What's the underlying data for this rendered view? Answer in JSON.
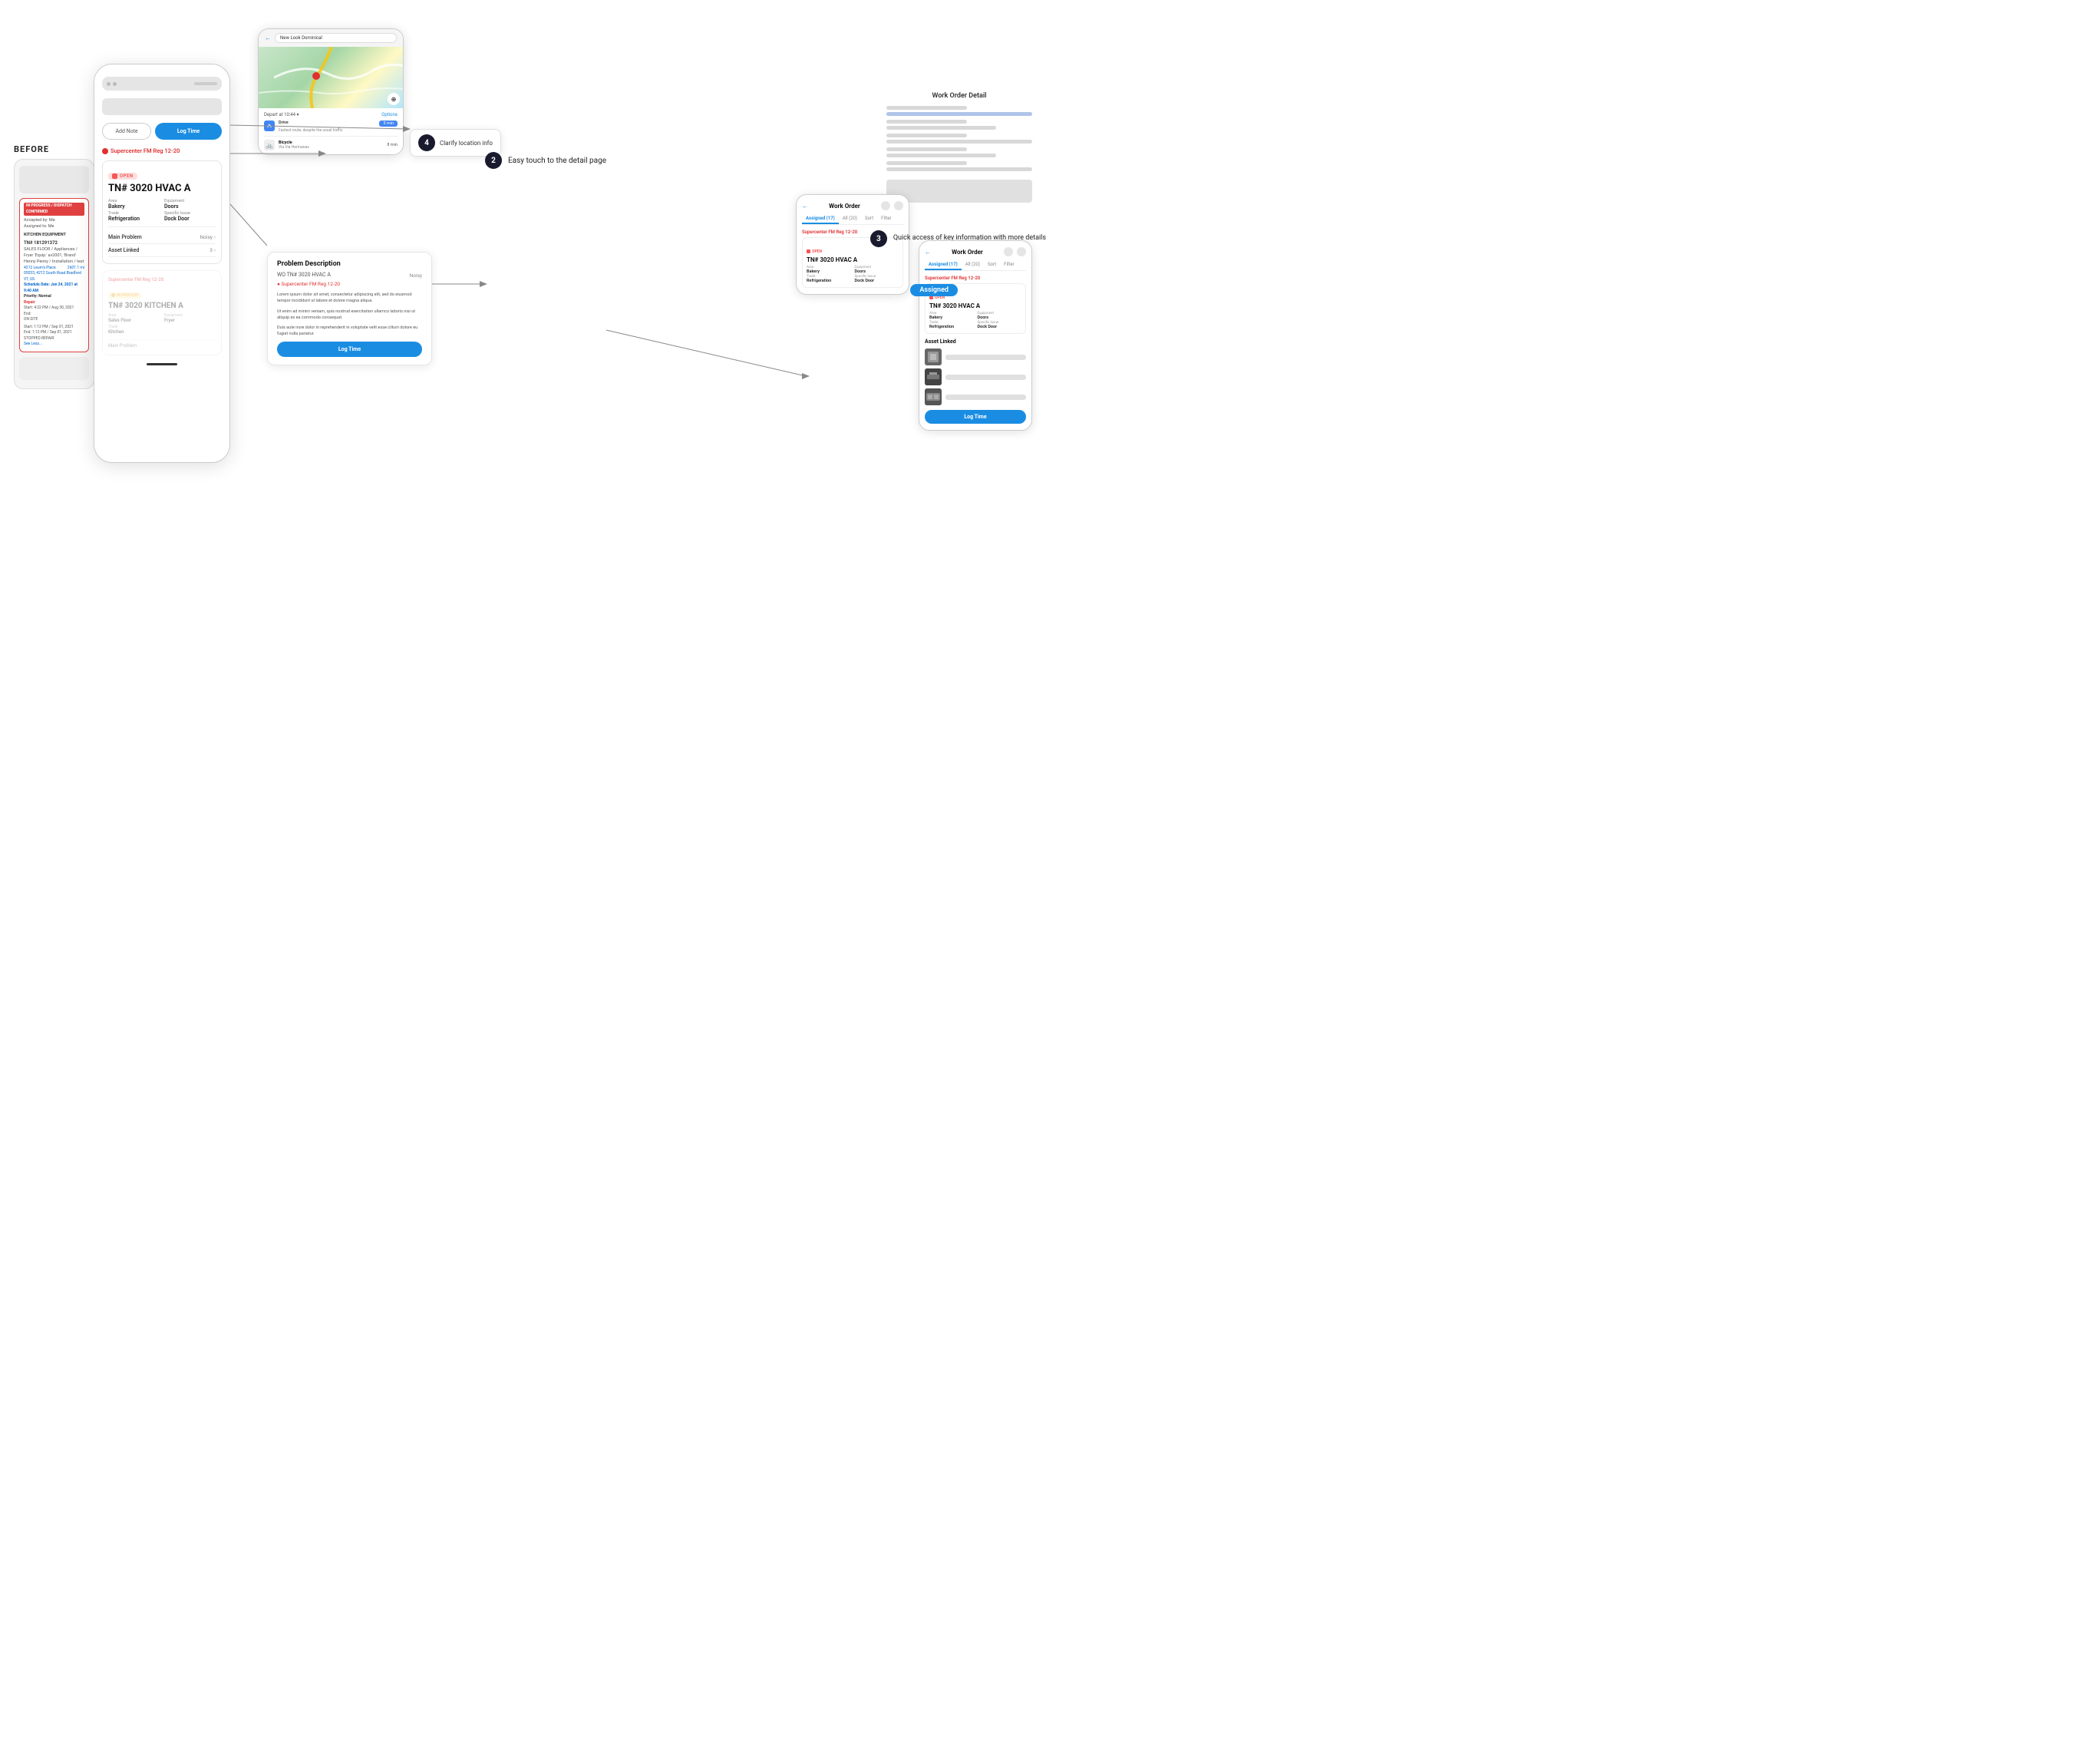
{
  "before_label": "BEFORE",
  "before_wo": {
    "status": "IN PROGRESS / DISPATCH CONFIRMED",
    "accepted": "Accepted by: Me",
    "assigned": "Assigned to: Me",
    "equipment": "KITCHEN EQUIPMENT",
    "tn": "TN# 181291372",
    "desc": "SALES FLOOR / Appliances / Fryer 'Equip.' av2001, 'Brand' Henny Penny / Installation / test",
    "addr1": "4212 Leurn's Place",
    "addr2": "05033, 4212 South Road Bradford VT, US",
    "sched": "Schedule Date: Jun 24, 2021 at 9:40 AM",
    "priority": "Priority: Normal",
    "repair1_label": "Repair",
    "repair1": "Start: 4:22 PM / Aug 30, 2021\nEnd:\nON SITE",
    "repair2": "Start: 1:12 PM / Sep 01, 2021\nEnd: 1:12 PM / Sep 01, 2021\nSTOPPED REPAIR",
    "see_less": "See Less..."
  },
  "main_phone": {
    "location": "Supercenter FM Reg 12-20",
    "wo_status": "OPEN",
    "wo_title": "TN# 3020 HVAC A",
    "area_label": "Area",
    "area_value": "Bakery",
    "equipment_label": "Equipment",
    "equipment_value": "Doors",
    "trade_label": "Trade",
    "trade_value": "Refrigeration",
    "specific_issue_label": "Specific Issue",
    "specific_issue_value": "Dock Door",
    "main_problem_label": "Main Problem",
    "main_problem_value": "Noisy",
    "asset_linked_label": "Asset Linked",
    "asset_linked_value": "3",
    "add_note_btn": "Add Note",
    "log_time_btn": "Log Time",
    "second_location": "Supercenter FM Reg 12-20",
    "second_status": "IN PROCESS",
    "second_title": "TN# 3020 KITCHEN A",
    "second_area_label": "Area",
    "second_area_value": "Sales Floor",
    "second_equip_label": "Equipment",
    "second_equip_value": "Fryer",
    "second_trade_label": "Trade",
    "second_trade_value": "Kitchen",
    "main_problem2": "Main Problem"
  },
  "callouts": {
    "num4": "4",
    "text4": "Clarify location info",
    "num2": "2",
    "text2": "Easy touch to the detail page",
    "num3": "3",
    "text3": "Quick access of key information with more details"
  },
  "wo_detail": {
    "title": "Work Order Detail"
  },
  "assigned_label": "Assigned",
  "map_phone": {
    "back": "←",
    "location": "New Look Dominical",
    "depart_label": "Depart at 10:44 ▾",
    "options": "Options",
    "drive_label": "Drive",
    "drive_fastest": "Fastest route, despite the usual traffic",
    "drive_time": "5 min",
    "bicycle_label": "Bicycle",
    "bicycle_via": "Via Via Hermanas",
    "bicycle_time": "8 min"
  },
  "phone3": {
    "back": "←",
    "title": "Work Order",
    "tabs": [
      "Assigned (17)",
      "All (20)",
      "Sort",
      "Filter"
    ],
    "active_tab": "Assigned (17)",
    "location": "Supercenter FM Reg 12-20",
    "status": "OPEN",
    "wo_title": "TN# 3020 HVAC A",
    "area_label": "Area",
    "area_value": "Bakery",
    "equip_label": "Equipment",
    "equip_value": "Doors",
    "trade_label": "Trade",
    "trade_value": "Refrigeration",
    "si_label": "Specific Issue",
    "si_value": "Dock Door"
  },
  "prob_panel": {
    "title": "Problem Description",
    "wo_ref": "WO TN# 3020 HVAC A",
    "noisy": "Noisy",
    "location": "Supercenter FM Reg 12-20",
    "body1": "Lorem ipsum dolor sit amet, consectetur adipiscing elit, sed do eiusmod tempor incididunt ut labore et dolore magna aliqua.",
    "body2": "Ut enim ad minim veniam, quis nostrud exercitation ullamco laboris nisi ut aliquip ex ea commodo consequat.",
    "body3": "Duis aute irure dolor in reprehenderit in voluptate velit esse cillum dolore eu fugiat nulla pariatur.",
    "log_btn": "Log Time"
  },
  "phone4": {
    "back": "←",
    "title": "Work Order",
    "tabs": [
      "Assigned (17)",
      "All (20)",
      "Sort",
      "Filter"
    ],
    "location": "Supercenter FM Reg 12-20",
    "status": "OPEN",
    "wo_title": "TN# 3020 HVAC A",
    "area_label": "Area",
    "area_value": "Bakery",
    "equip_label": "Equipment",
    "equip_value": "Doors",
    "trade_label": "Trade",
    "trade_value": "Refrigeration",
    "si_label": "Specific Issue",
    "si_value": "Dock Door",
    "asset_linked": "Asset Linked",
    "log_btn": "Log Time"
  }
}
